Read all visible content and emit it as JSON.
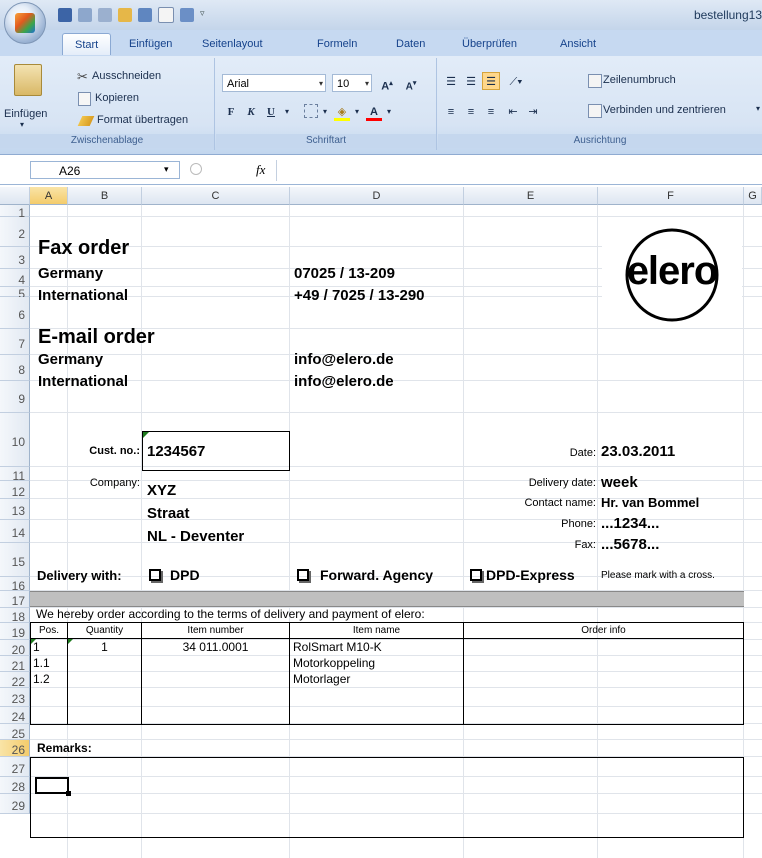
{
  "window": {
    "title": "bestellung13"
  },
  "ribbon_tabs": [
    "Start",
    "Einfügen",
    "Seitenlayout",
    "Formeln",
    "Daten",
    "Überprüfen",
    "Ansicht"
  ],
  "clipboard": {
    "paste": "Einfügen",
    "cut": "Ausschneiden",
    "copy": "Kopieren",
    "format": "Format übertragen",
    "label": "Zwischenablage"
  },
  "font": {
    "name": "Arial",
    "size": "10",
    "bold": "F",
    "italic": "K",
    "underline": "U",
    "label": "Schriftart"
  },
  "alignment": {
    "wrap": "Zeilenumbruch",
    "merge": "Verbinden und zentrieren",
    "label": "Ausrichtung"
  },
  "formula_bar": {
    "name_box": "A26",
    "fx": "fx",
    "formula": ""
  },
  "columns": [
    "A",
    "B",
    "C",
    "D",
    "E",
    "F",
    "G"
  ],
  "rows": [
    "1",
    "2",
    "3",
    "4",
    "5",
    "6",
    "7",
    "8",
    "9",
    "10",
    "11",
    "12",
    "13",
    "14",
    "15",
    "16",
    "17",
    "18",
    "19",
    "20",
    "21",
    "22",
    "23",
    "24",
    "25",
    "26",
    "27",
    "28",
    "29"
  ],
  "sheet": {
    "fax_title": "Fax order",
    "fax_de_label": "Germany",
    "fax_de_num": "07025 / 13-209",
    "fax_int_label": "International",
    "fax_int_num": "+49 / 7025 / 13-290",
    "email_title": "E-mail order",
    "email_de_label": "Germany",
    "email_de": "info@elero.de",
    "email_int_label": "International",
    "email_int": "info@elero.de",
    "logo": "elero",
    "cust_no_label": "Cust. no.:",
    "cust_no": "1234567",
    "company_label": "Company:",
    "company_name": "XYZ",
    "company_street": "Straat",
    "company_city": "NL - Deventer",
    "date_label": "Date:",
    "date": "23.03.2011",
    "delivery_date_label": "Delivery date:",
    "delivery_date": "week",
    "contact_label": "Contact name:",
    "contact": "Hr. van Bommel",
    "phone_label": "Phone:",
    "phone": "...1234...",
    "fax_label": "Fax:",
    "fax": "...5678...",
    "delivery_with": "Delivery with:",
    "opt_dpd": "DPD",
    "opt_agency": "Forward. Agency",
    "opt_express": "DPD-Express",
    "mark_note": "Please mark with a cross.",
    "terms": "We hereby order according to the terms of delivery and payment of elero:",
    "table_headers": {
      "pos": "Pos.",
      "qty": "Quantity",
      "item_no": "Item number",
      "item_name": "Item name",
      "order_info": "Order info"
    },
    "items": [
      {
        "pos": "1",
        "qty": "1",
        "item_no": "34 011.0001",
        "name": "RolSmart M10-K"
      },
      {
        "pos": "1.1",
        "qty": "",
        "item_no": "",
        "name": "Motorkoppeling"
      },
      {
        "pos": "1.2",
        "qty": "",
        "item_no": "",
        "name": "Motorlager"
      }
    ],
    "remarks_label": "Remarks:"
  }
}
